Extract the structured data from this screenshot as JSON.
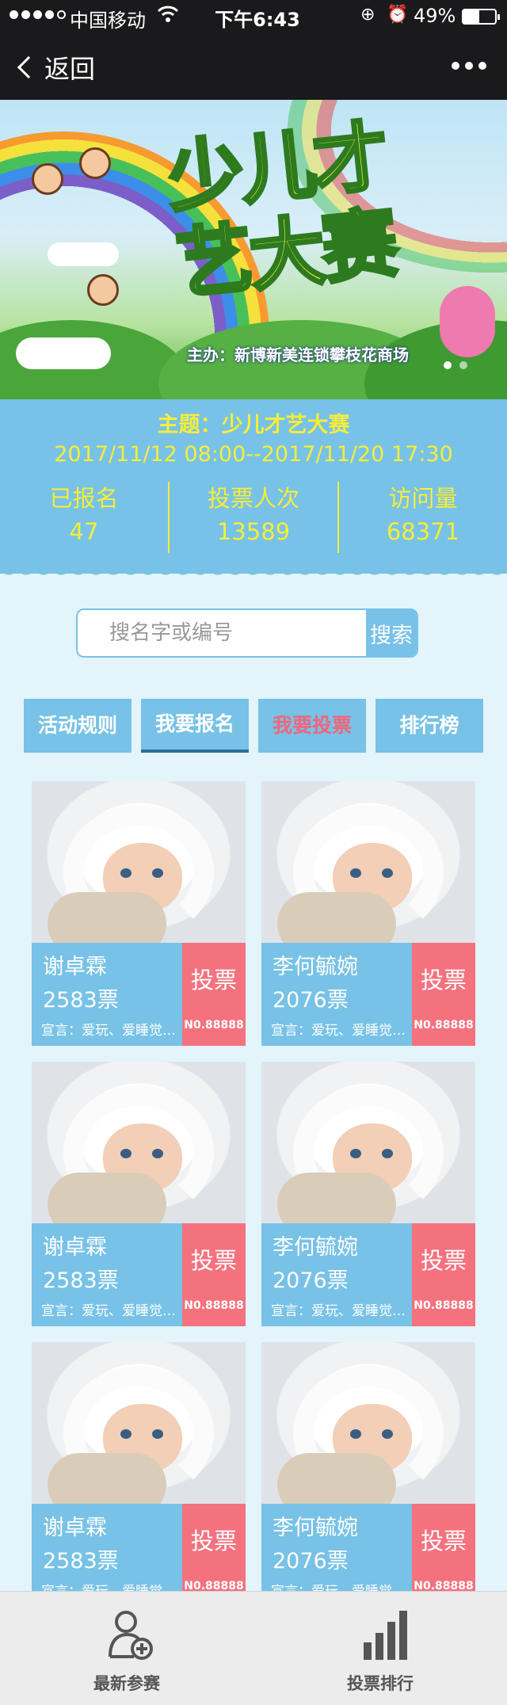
{
  "status_bar": {
    "carrier": "中国移动",
    "time": "下午6:43",
    "battery": "49%",
    "battery_level": 0.49,
    "icons": [
      "signal-dots-icon",
      "wifi-icon",
      "rotation-lock-icon",
      "alarm-icon",
      "battery-icon"
    ]
  },
  "nav": {
    "back_label": "返回",
    "more_icon": "more-dots-icon"
  },
  "banner": {
    "title": "少儿才艺大赛",
    "organizer": "主办：新博新美连锁攀枝花商场"
  },
  "event": {
    "subject": "主题：少儿才艺大赛",
    "date_range": "2017/11/12 08:00--2017/11/20 17:30",
    "stats": [
      {
        "label": "已报名",
        "value": "47"
      },
      {
        "label": "投票人次",
        "value": "13589"
      },
      {
        "label": "访问量",
        "value": "68371"
      }
    ]
  },
  "search": {
    "placeholder": "搜名字或编号",
    "button_label": "搜索"
  },
  "tabs": [
    {
      "label": "活动规则"
    },
    {
      "label": "我要报名"
    },
    {
      "label": "我要投票"
    },
    {
      "label": "排行榜"
    }
  ],
  "entries": [
    {
      "name": "谢卓霖",
      "votes": "2583票",
      "motto": "宣言：爱玩、爱睡觉、爱吃",
      "vote_label": "投票",
      "number": "N0.88888"
    },
    {
      "name": "李何毓婉",
      "votes": "2076票",
      "motto": "宣言：爱玩、爱睡觉、爱吃",
      "vote_label": "投票",
      "number": "N0.88888"
    },
    {
      "name": "谢卓霖",
      "votes": "2583票",
      "motto": "宣言：爱玩、爱睡觉、爱吃",
      "vote_label": "投票",
      "number": "N0.88888"
    },
    {
      "name": "李何毓婉",
      "votes": "2076票",
      "motto": "宣言：爱玩、爱睡觉、爱吃",
      "vote_label": "投票",
      "number": "N0.88888"
    },
    {
      "name": "谢卓霖",
      "votes": "2583票",
      "motto": "宣言：爱玩、爱睡觉、爱吃",
      "vote_label": "投票",
      "number": "N0.88888"
    },
    {
      "name": "李何毓婉",
      "votes": "2076票",
      "motto": "宣言：爱玩、爱睡觉、爱吃",
      "vote_label": "投票",
      "number": "N0.88888"
    }
  ],
  "bottom_nav": [
    {
      "label": "最新参赛",
      "icon": "add-user-icon"
    },
    {
      "label": "投票排行",
      "icon": "bar-chart-icon"
    }
  ],
  "colors": {
    "primary": "#77c2e6",
    "accent_yellow": "#f7ed3a",
    "vote_pink": "#f4727e",
    "background": "#e3f4fb"
  }
}
